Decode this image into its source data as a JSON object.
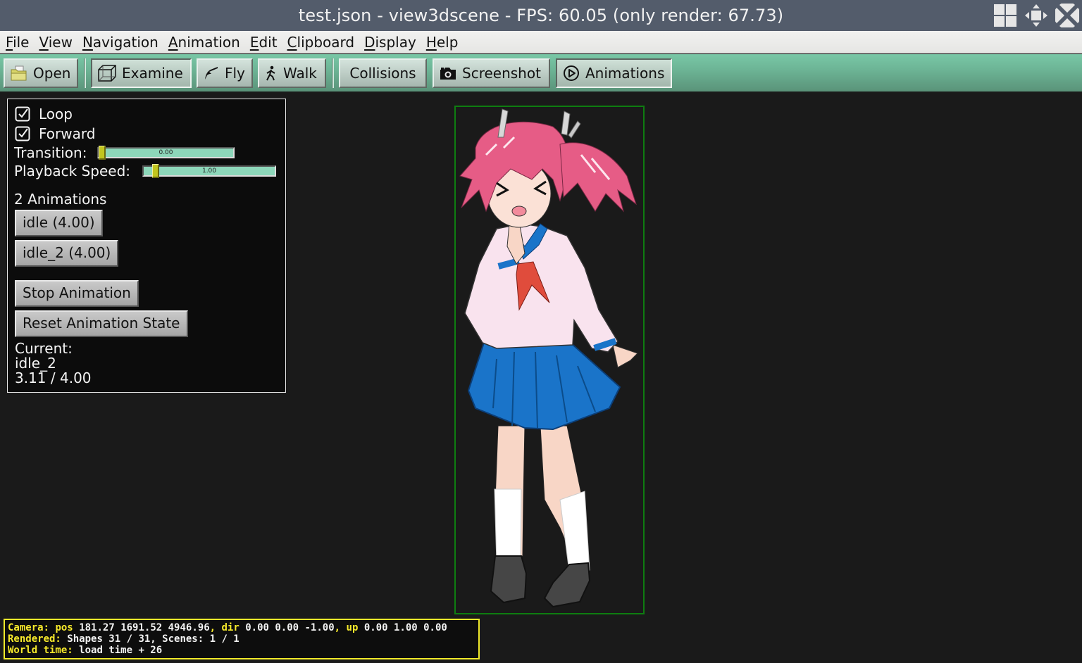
{
  "window": {
    "title": "test.json - view3dscene - FPS: 60.05 (only render: 67.73)",
    "controls": [
      {
        "name": "tile-icon"
      },
      {
        "name": "move-icon"
      },
      {
        "name": "close-icon"
      }
    ]
  },
  "menubar": {
    "items": [
      {
        "mnemonic": "F",
        "rest": "ile",
        "label": "File"
      },
      {
        "mnemonic": "V",
        "rest": "iew",
        "label": "View"
      },
      {
        "mnemonic": "N",
        "rest": "avigation",
        "label": "Navigation"
      },
      {
        "mnemonic": "A",
        "rest": "nimation",
        "label": "Animation"
      },
      {
        "mnemonic": "E",
        "rest": "dit",
        "label": "Edit"
      },
      {
        "mnemonic": "C",
        "rest": "lipboard",
        "label": "Clipboard"
      },
      {
        "mnemonic": "D",
        "rest": "isplay",
        "label": "Display"
      },
      {
        "mnemonic": "H",
        "rest": "elp",
        "label": "Help"
      }
    ]
  },
  "toolbar": {
    "open": {
      "label": "Open",
      "icon": "folder-icon"
    },
    "examine": {
      "label": "Examine",
      "icon": "cube-icon",
      "pressed": true
    },
    "fly": {
      "label": "Fly",
      "icon": "bird-icon"
    },
    "walk": {
      "label": "Walk",
      "icon": "walking-person-icon"
    },
    "collisions": {
      "label": "Collisions"
    },
    "screenshot": {
      "label": "Screenshot",
      "icon": "camera-icon"
    },
    "animations": {
      "label": "Animations",
      "icon": "play-circle-icon",
      "pressed": true
    }
  },
  "animation_panel": {
    "loop": {
      "label": "Loop",
      "checked": true
    },
    "forward": {
      "label": "Forward",
      "checked": true
    },
    "transition": {
      "label": "Transition:",
      "value": "0.00",
      "fraction": 0.0
    },
    "playback_speed": {
      "label": "Playback Speed:",
      "value": "1.00",
      "fraction": 0.07
    },
    "count_label": "2 Animations",
    "animations": [
      {
        "label": "idle (4.00)"
      },
      {
        "label": "idle_2 (4.00)"
      }
    ],
    "stop_label": "Stop Animation",
    "reset_label": "Reset Animation State",
    "current_label": "Current:",
    "current_name": "idle_2",
    "current_time": "3.11 / 4.00"
  },
  "viewport": {
    "model": "anime schoolgirl character (pink twin-tail hair, sailor uniform, blue skirt)",
    "bbox_color": "#0e7d10"
  },
  "status": {
    "camera_label": "Camera:",
    "pos_label": "pos",
    "pos_value": "181.27 1691.52 4946.96",
    "dir_label": "dir",
    "dir_value": "0.00 0.00 -1.00",
    "up_label": "up",
    "up_value": "0.00 1.00 0.00",
    "rendered_label": "Rendered:",
    "rendered_value": "Shapes 31 / 31, Scenes: 1 / 1",
    "world_time_label": "World time:",
    "world_time_value": "load time + 26"
  },
  "colors": {
    "titlebar": "#535c6b",
    "toolbar_accent": "#6db596",
    "status_label": "#f7ea2b",
    "slider_fill": "#8dd7ba",
    "slider_thumb": "#c1c51f"
  }
}
